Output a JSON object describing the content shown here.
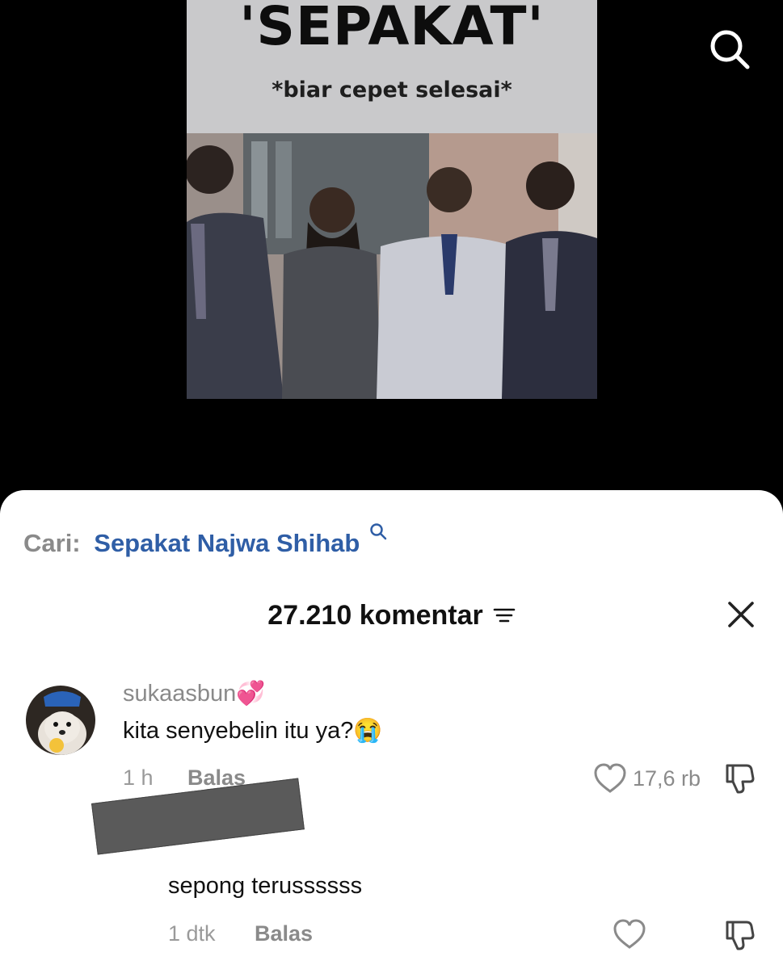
{
  "video": {
    "meme_title": "'SEPAKAT'",
    "meme_subtitle": "*biar cepet selesai*",
    "search_icon": "search-icon"
  },
  "sheet": {
    "search_suggestion": {
      "label": "Cari:",
      "query": "Sepakat Najwa Shihab",
      "icon": "search-icon"
    },
    "comment_count": "27.210 komentar",
    "filter_icon": "filter-icon",
    "close_icon": "close-icon"
  },
  "comments": [
    {
      "username": "sukaasbun💞",
      "text": "kita senyebelin itu ya?😭",
      "time": "1 h",
      "reply_label": "Balas",
      "likes": "17,6 rb"
    },
    {
      "username": "",
      "text": "sepong terussssss",
      "time": "1 dtk",
      "reply_label": "Balas",
      "likes": ""
    }
  ],
  "colors": {
    "link_blue": "#2f5ea6",
    "muted_gray": "#8a8a8a",
    "redaction": "#5a5a5a"
  }
}
